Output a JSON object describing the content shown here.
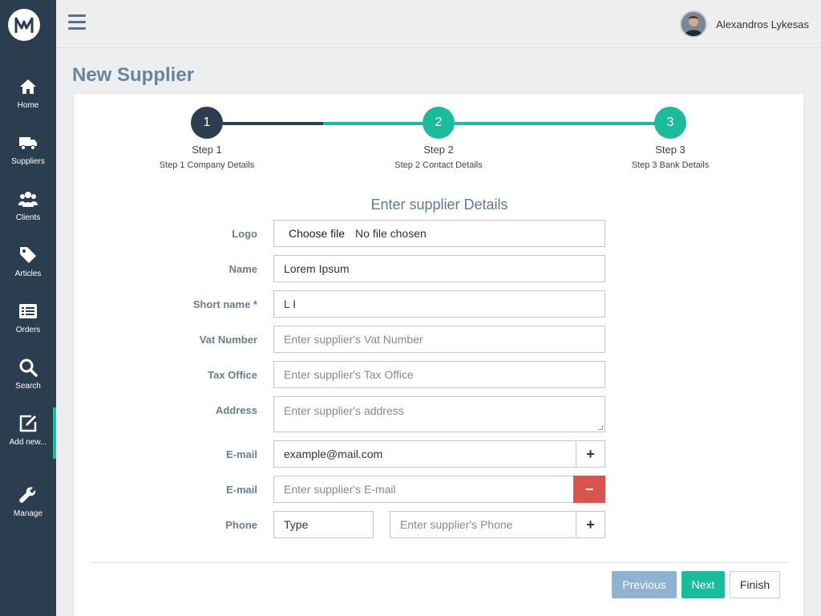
{
  "app": {
    "logo_text": "M"
  },
  "sidebar": {
    "items": [
      {
        "label": "Home",
        "icon": "home-icon"
      },
      {
        "label": "Suppliers",
        "icon": "truck-icon"
      },
      {
        "label": "Clients",
        "icon": "users-icon"
      },
      {
        "label": "Articles",
        "icon": "tag-icon"
      },
      {
        "label": "Orders",
        "icon": "list-icon"
      },
      {
        "label": "Search",
        "icon": "search-icon"
      },
      {
        "label": "Add new...",
        "icon": "edit-icon",
        "active": true
      },
      {
        "label": "Manage",
        "icon": "wrench-icon"
      }
    ]
  },
  "header": {
    "user_name": "Alexandros Lykesas"
  },
  "page": {
    "title": "New Supplier"
  },
  "wizard": {
    "steps": [
      {
        "number": "1",
        "label": "Step 1",
        "sub": "Step 1 Company Details",
        "color": "#2d3e50"
      },
      {
        "number": "2",
        "label": "Step 2",
        "sub": "Step 2 Contact Details",
        "color": "#1abc9c"
      },
      {
        "number": "3",
        "label": "Step 3",
        "sub": "Step 3 Bank Details",
        "color": "#1abc9c"
      }
    ]
  },
  "form": {
    "heading": "Enter supplier Details",
    "logo": {
      "label": "Logo",
      "button": "Choose file",
      "status": "No file chosen"
    },
    "name": {
      "label": "Name",
      "value": "Lorem Ipsum"
    },
    "short_name": {
      "label": "Short name *",
      "value": "L I"
    },
    "vat": {
      "label": "Vat Number",
      "placeholder": "Enter supplier's Vat Number"
    },
    "tax_office": {
      "label": "Tax Office",
      "placeholder": "Enter supplier's Tax Office"
    },
    "address": {
      "label": "Address",
      "placeholder": "Enter supplier's address"
    },
    "email1": {
      "label": "E-mail",
      "value": "example@mail.com",
      "addon": "+"
    },
    "email2": {
      "label": "E-mail",
      "placeholder": "Enter supplier's E-mail",
      "addon": "−"
    },
    "phone": {
      "label": "Phone",
      "type_value": "Type",
      "placeholder": "Enter supplier's Phone",
      "addon": "+"
    }
  },
  "buttons": {
    "previous": "Previous",
    "next": "Next",
    "finish": "Finish"
  }
}
